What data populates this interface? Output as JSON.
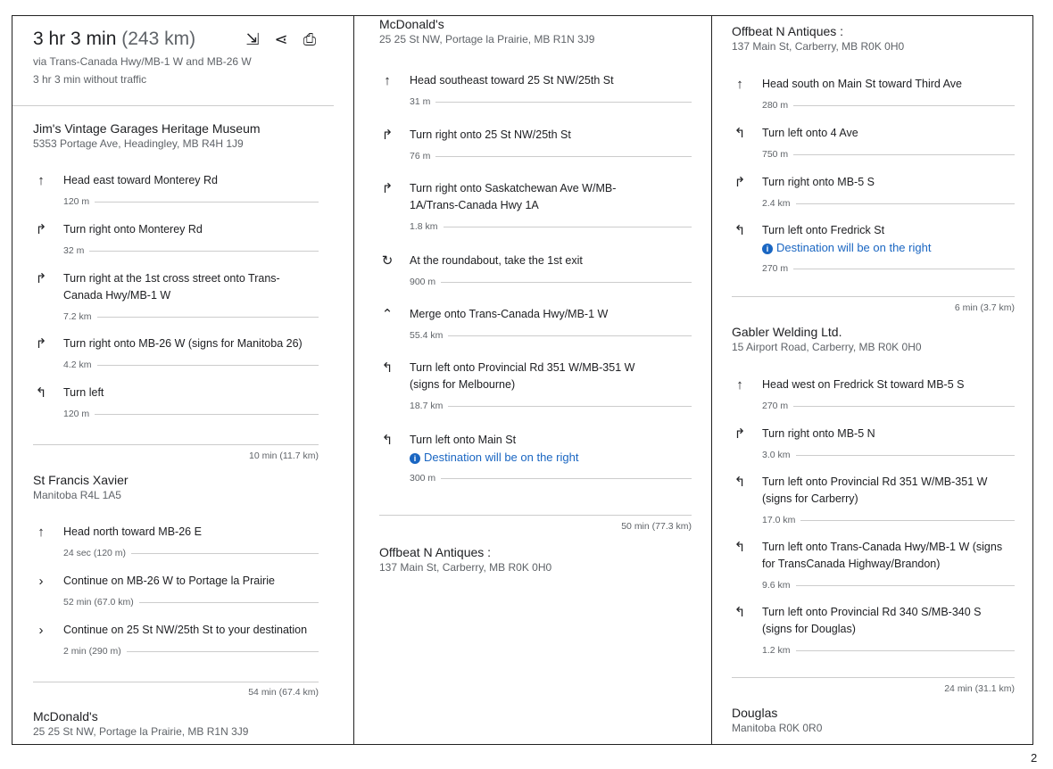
{
  "summary": {
    "time": "3 hr 3 min",
    "distance": "(243 km)",
    "via": "via Trans-Canada Hwy/MB-1 W and MB-26 W",
    "traffic": "3 hr 3 min without traffic"
  },
  "actions": {
    "send": "send-to-phone-icon",
    "share": "share-icon",
    "print": "print-icon"
  },
  "col1": {
    "place1": {
      "name": "Jim's Vintage Garages Heritage Museum",
      "addr": "5353 Portage Ave, Headingley, MB R4H 1J9"
    },
    "steps1": [
      {
        "icon": "↑",
        "text": "Head east toward Monterey Rd",
        "dist": "120 m"
      },
      {
        "icon": "↱",
        "text": "Turn right onto Monterey Rd",
        "dist": "32 m"
      },
      {
        "icon": "↱",
        "text": "Turn right at the 1st cross street onto Trans-",
        "text2": "Canada Hwy/MB-1 W",
        "dist": "7.2 km"
      },
      {
        "icon": "↱",
        "text": "Turn right onto MB-26 W (signs for Manitoba 26)",
        "dist": "4.2 km"
      },
      {
        "icon": "↰",
        "text": "Turn left",
        "dist": "120 m"
      }
    ],
    "leg1": "10 min (11.7 km)",
    "place2": {
      "name": "St Francis Xavier",
      "addr": "Manitoba R4L 1A5"
    },
    "steps2": [
      {
        "icon": "↑",
        "text": "Head north toward MB-26 E",
        "dist": "24 sec (120 m)"
      },
      {
        "icon": "›",
        "text": "Continue on MB-26 W to Portage la Prairie",
        "dist": "52 min (67.0 km)"
      },
      {
        "icon": "›",
        "text": "Continue on 25 St NW/25th St to your destination",
        "dist": "2 min (290 m)"
      }
    ],
    "leg2": "54 min (67.4 km)",
    "place3": {
      "name": "McDonald's",
      "addr": "25 25 St NW, Portage la Prairie, MB R1N 3J9"
    }
  },
  "col2": {
    "place1": {
      "name": "McDonald's",
      "addr": "25 25 St NW, Portage la Prairie, MB R1N 3J9"
    },
    "steps": [
      {
        "icon": "↑",
        "text": "Head southeast toward 25 St NW/25th St",
        "dist": "31 m"
      },
      {
        "icon": "↱",
        "text": "Turn right onto 25 St NW/25th St",
        "dist": "76 m"
      },
      {
        "icon": "↱",
        "text": "Turn right onto Saskatchewan Ave W/MB-",
        "text2": "1A/Trans-Canada Hwy 1A",
        "dist": "1.8 km"
      },
      {
        "icon": "↻",
        "text": "At the roundabout, take the 1st exit",
        "dist": "900 m"
      },
      {
        "icon": "⌃",
        "text": "Merge onto Trans-Canada Hwy/MB-1 W",
        "dist": "55.4 km"
      },
      {
        "icon": "↰",
        "text": "Turn left onto Provincial Rd 351 W/MB-351 W",
        "text2": "(signs for Melbourne)",
        "dist": "18.7 km"
      },
      {
        "icon": "↰",
        "text": "Turn left onto Main St",
        "note": "Destination will be on the right",
        "dist": "300 m"
      }
    ],
    "leg": "50 min (77.3 km)",
    "place2": {
      "name": "Offbeat N Antiques :",
      "addr": "137 Main St, Carberry, MB R0K 0H0"
    }
  },
  "col3": {
    "place1": {
      "name": "Offbeat N Antiques :",
      "addr": "137 Main St, Carberry, MB R0K 0H0"
    },
    "steps1": [
      {
        "icon": "↑",
        "text": "Head south on Main St toward Third Ave",
        "dist": "280 m"
      },
      {
        "icon": "↰",
        "text": "Turn left onto 4 Ave",
        "dist": "750 m"
      },
      {
        "icon": "↱",
        "text": "Turn right onto MB-5 S",
        "dist": "2.4 km"
      },
      {
        "icon": "↰",
        "text": "Turn left onto Fredrick St",
        "note": "Destination will be on the right",
        "dist": "270 m"
      }
    ],
    "leg1": "6 min (3.7 km)",
    "place2": {
      "name": "Gabler Welding Ltd.",
      "addr": "15 Airport Road, Carberry, MB R0K 0H0"
    },
    "steps2": [
      {
        "icon": "↑",
        "text": "Head west on Fredrick St toward MB-5 S",
        "dist": "270 m"
      },
      {
        "icon": "↱",
        "text": "Turn right onto MB-5 N",
        "dist": "3.0 km"
      },
      {
        "icon": "↰",
        "text": "Turn left onto Provincial Rd 351 W/MB-351 W",
        "text2": "(signs for Carberry)",
        "dist": "17.0 km"
      },
      {
        "icon": "↰",
        "text": "Turn left onto Trans-Canada Hwy/MB-1 W (signs",
        "text2": "for TransCanada Highway/Brandon)",
        "dist": "9.6 km"
      },
      {
        "icon": "↰",
        "text": "Turn left onto Provincial Rd 340 S/MB-340 S",
        "text2": "(signs for Douglas)",
        "dist": "1.2 km"
      }
    ],
    "leg2": "24 min (31.1 km)",
    "place3": {
      "name": "Douglas",
      "addr": "Manitoba R0K 0R0"
    }
  },
  "page_number": "2"
}
